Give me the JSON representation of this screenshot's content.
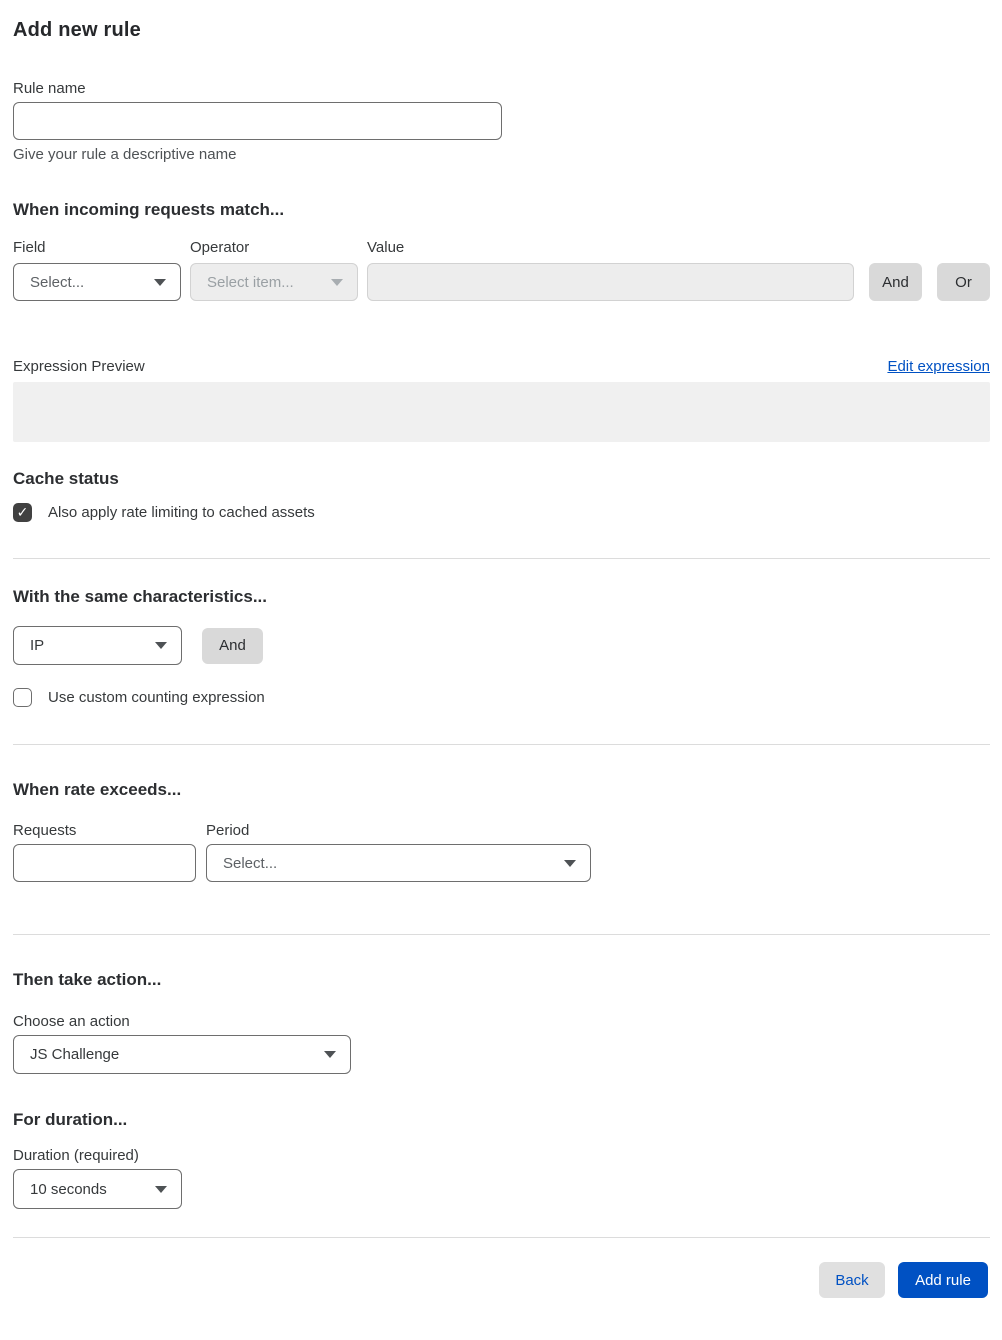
{
  "page": {
    "title": "Add new rule"
  },
  "rule_name": {
    "label": "Rule name",
    "value": "",
    "helper": "Give your rule a descriptive name"
  },
  "match_section": {
    "heading": "When incoming requests match...",
    "field": {
      "label": "Field",
      "selected": "Select..."
    },
    "operator": {
      "label": "Operator",
      "selected": "Select item...",
      "disabled": true
    },
    "value": {
      "label": "Value",
      "value": "",
      "disabled": true
    },
    "and_button": "And",
    "or_button": "Or",
    "expression_preview_label": "Expression Preview",
    "edit_expression_link": "Edit expression",
    "expression_preview_value": ""
  },
  "cache_section": {
    "heading": "Cache status",
    "checkbox_label": "Also apply rate limiting to cached assets",
    "checked": true
  },
  "characteristics_section": {
    "heading": "With the same characteristics...",
    "characteristic_selected": "IP",
    "and_button": "And",
    "custom_counting_label": "Use custom counting expression",
    "custom_counting_checked": false
  },
  "rate_section": {
    "heading": "When rate exceeds...",
    "requests": {
      "label": "Requests",
      "value": ""
    },
    "period": {
      "label": "Period",
      "selected": "Select..."
    }
  },
  "action_section": {
    "heading": "Then take action...",
    "choose_label": "Choose an action",
    "action_selected": "JS Challenge"
  },
  "duration_section": {
    "heading": "For duration...",
    "label": "Duration (required)",
    "duration_selected": "10 seconds"
  },
  "footer": {
    "back_button": "Back",
    "add_rule_button": "Add rule"
  },
  "icons": {
    "checkmark": "✓"
  },
  "colors": {
    "accent_blue": "#0051c3",
    "checkbox_checked": "#414141",
    "disabled_bg": "#ededed",
    "preview_bg": "#f0f0f0",
    "gray_button": "#d9d9d9"
  }
}
